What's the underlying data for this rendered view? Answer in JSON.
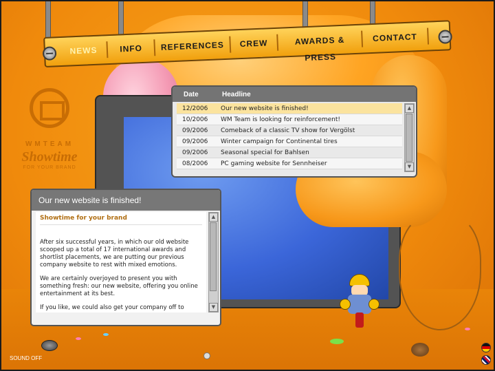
{
  "nav": {
    "items": [
      {
        "label": "NEWS",
        "active": true
      },
      {
        "label": "INFO",
        "active": false
      },
      {
        "label": "REFERENCES",
        "active": false
      },
      {
        "label": "CREW",
        "active": false
      },
      {
        "label": "AWARDS & PRESS",
        "active": false
      },
      {
        "label": "CONTACT",
        "active": false
      }
    ]
  },
  "logo": {
    "team": "WMTEAM",
    "name": "Showtime",
    "tagline": "FOR YOUR BRAND"
  },
  "news_table": {
    "headers": {
      "date": "Date",
      "headline": "Headline"
    },
    "rows": [
      {
        "date": "12/2006",
        "headline": "Our new website is finished!",
        "selected": true
      },
      {
        "date": "10/2006",
        "headline": "WM Team is looking for reinforcement!",
        "selected": false
      },
      {
        "date": "09/2006",
        "headline": "Comeback of a classic TV show for Vergölst",
        "selected": false
      },
      {
        "date": "09/2006",
        "headline": "Winter campaign for Continental tires",
        "selected": false
      },
      {
        "date": "09/2006",
        "headline": "Seasonal special for Bahlsen",
        "selected": false
      },
      {
        "date": "08/2006",
        "headline": "PC gaming website for Sennheiser",
        "selected": false
      }
    ]
  },
  "article": {
    "title": "Our new website is finished!",
    "subtitle": "Showtime for your brand",
    "paragraphs": [
      "After six successful years, in which our old website scooped up a total of 17 international awards and shortlist placements, we are putting our previous company website to rest with mixed emotions.",
      "We are certainly overjoyed to present you with something fresh: our new website, offering you online entertainment at its best.",
      "If you like, we could also get your company off to"
    ]
  },
  "footer": {
    "sound_label": "SOUND OFF"
  },
  "icons": {
    "scroll_up": "▲",
    "scroll_down": "▼"
  },
  "colors": {
    "background": "#f08a0c",
    "accent": "#c86d04",
    "selected_row": "#fbe39e"
  }
}
